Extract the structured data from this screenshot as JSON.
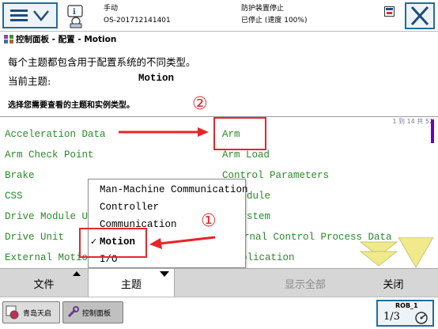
{
  "header": {
    "mode": "手动",
    "controller": "OS-201712141401",
    "safety": "防护装置停止",
    "state": "已停止 (速度 100%)"
  },
  "breadcrumb": "控制面板 - 配置 - Motion",
  "description": {
    "line1": "每个主题都包含用于配置系统的不同类型。",
    "topic_label": "当前主题:",
    "topic_value": "Motion",
    "instruction": "选择您需要查看的主题和实例类型。"
  },
  "list": {
    "pager": "1 到 14 共 52",
    "left": [
      "Acceleration Data",
      "Arm Check Point",
      "Brake",
      "CSS",
      "Drive Module User",
      "Drive Unit",
      "External Motion"
    ],
    "right": [
      "Arm",
      "Arm Load",
      "Control Parameters",
      "Drive Module",
      "Drive System",
      "External Control Process Data",
      "Application"
    ]
  },
  "popup": {
    "items": [
      "Man-Machine Communication",
      "Controller",
      "Communication",
      "Motion",
      "I/O"
    ],
    "checkmark": "✓"
  },
  "annotations": {
    "one": "①",
    "two": "②"
  },
  "toolbar": {
    "file": "文件",
    "topic": "主题",
    "show_all": "显示全部",
    "close": "关闭"
  },
  "taskbar": {
    "app1": "青岛天启",
    "app2": "控制面板",
    "robot": "ROB_1",
    "fraction": "1/3"
  },
  "colors": {
    "item_green": "#2a8a2a",
    "annotation_red": "#e8252a",
    "frame_blue": "#1f6d9c",
    "scroll_purple": "#6a00c8",
    "arrow_yellow": "#f0ea8a"
  },
  "icons": [
    "menu-icon",
    "chevron-down-icon",
    "info-status-icon",
    "minimize-icon",
    "close-icon",
    "control-panel-icon",
    "scroll-down-icon",
    "page-down-icon",
    "speed-dial-icon"
  ]
}
